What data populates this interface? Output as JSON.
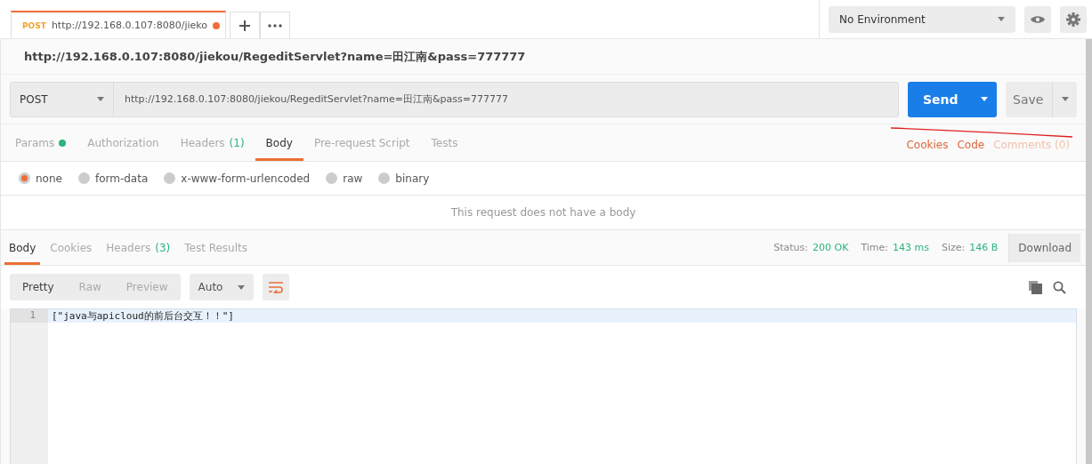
{
  "request_tabs": [
    {
      "method": "POST",
      "title": "http://192.168.0.107:8080/jieko",
      "unsaved": true,
      "selected": true
    }
  ],
  "environment": {
    "value": "No Environment"
  },
  "request_title": "http://192.168.0.107:8080/jiekou/RegeditServlet?name=田江南&pass=777777",
  "request": {
    "method": "POST",
    "url": "http://192.168.0.107:8080/jiekou/RegeditServlet?name=田江南&pass=777777",
    "send": "Send",
    "save": "Save"
  },
  "option_tabs": [
    {
      "label": "Params",
      "dot": true,
      "selected": false
    },
    {
      "label": "Authorization",
      "selected": false
    },
    {
      "label": "Headers",
      "count": "(1)",
      "selected": false
    },
    {
      "label": "Body",
      "selected": true
    },
    {
      "label": "Pre-request Script",
      "selected": false
    },
    {
      "label": "Tests",
      "selected": false
    }
  ],
  "side_links": [
    {
      "label": "Cookies",
      "disabled": false
    },
    {
      "label": "Code",
      "disabled": false
    },
    {
      "label": "Comments (0)",
      "disabled": true
    }
  ],
  "body_modes": [
    {
      "label": "none",
      "selected": true
    },
    {
      "label": "form-data",
      "selected": false
    },
    {
      "label": "x-www-form-urlencoded",
      "selected": false
    },
    {
      "label": "raw",
      "selected": false
    },
    {
      "label": "binary",
      "selected": false
    }
  ],
  "empty_body_message": "This request does not have a body",
  "response_tabs": [
    {
      "label": "Body",
      "selected": true
    },
    {
      "label": "Cookies",
      "selected": false
    },
    {
      "label": "Headers",
      "count": "(3)",
      "selected": false
    },
    {
      "label": "Test Results",
      "selected": false
    }
  ],
  "response_meta": [
    {
      "label": "Status:",
      "value": "200 OK"
    },
    {
      "label": "Time:",
      "value": "143 ms"
    },
    {
      "label": "Size:",
      "value": "146 B"
    }
  ],
  "download": "Download",
  "view_modes": [
    {
      "label": "Pretty",
      "selected": true
    },
    {
      "label": "Raw",
      "selected": false
    },
    {
      "label": "Preview",
      "selected": false
    }
  ],
  "format": "Auto",
  "wrap_lines": true,
  "code_lines": [
    {
      "number": "1",
      "text": "[\"java与apicloud的前后台交互！！\"]"
    }
  ]
}
